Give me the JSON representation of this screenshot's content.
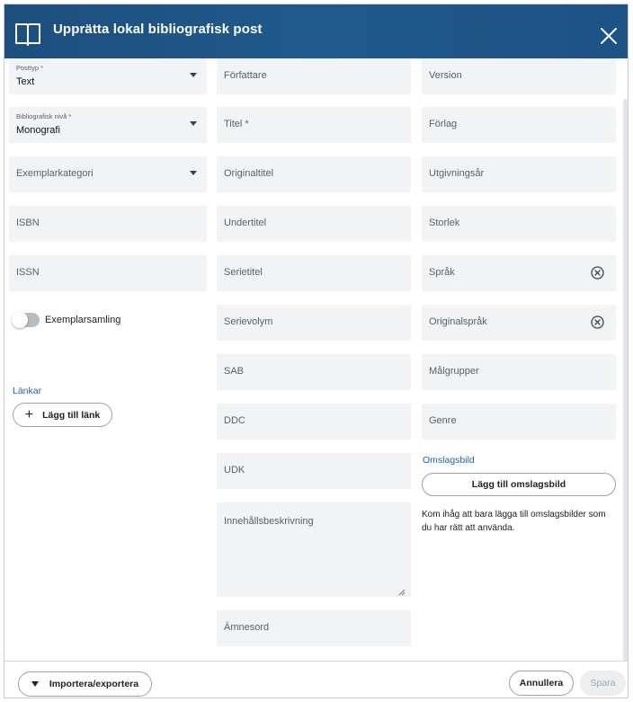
{
  "header": {
    "title": "Upprätta lokal bibliografisk post"
  },
  "left": {
    "posttyp": {
      "label": "Posttyp *",
      "value": "Text"
    },
    "niva": {
      "label": "Bibliografisk nivå *",
      "value": "Monografi"
    },
    "exemplarkategori": {
      "label": "Exemplarkategori"
    },
    "isbn": {
      "label": "ISBN"
    },
    "issn": {
      "label": "ISSN"
    },
    "toggle_label": "Exemplarsamling",
    "links_heading": "Länkar",
    "add_link_label": "Lägg till länk"
  },
  "middle": {
    "forfattare": "Författare",
    "titel": "Titel *",
    "originaltitel": "Originaltitel",
    "undertitel": "Undertitel",
    "serietitel": "Serietitel",
    "serievolym": "Serievolym",
    "sab": "SAB",
    "ddc": "DDC",
    "udk": "UDK",
    "innehall": "Innehållsbeskrivning",
    "amnesord": "Ämnesord"
  },
  "right": {
    "version": "Version",
    "forlag": "Förlag",
    "utgivningsar": "Utgivningsår",
    "storlek": "Storlek",
    "sprak": "Språk",
    "originalsprak": "Originalspråk",
    "malgrupper": "Målgrupper",
    "genre": "Genre",
    "cover_heading": "Omslagsbild",
    "add_cover_label": "Lägg till omslagsbild",
    "cover_note": "Kom ihåg att bara lägga till omslagsbilder som du har rätt att använda."
  },
  "footer": {
    "import_export_label": "Importera/exportera",
    "cancel_label": "Annullera",
    "save_label": "Spara"
  },
  "colors": {
    "header": "#1d5285",
    "field_bg": "#f1f3f5",
    "link": "#1f63a8"
  },
  "icons": [
    "book-icon",
    "close-icon",
    "caret-down-icon",
    "clear-circle-icon",
    "plus-icon"
  ]
}
